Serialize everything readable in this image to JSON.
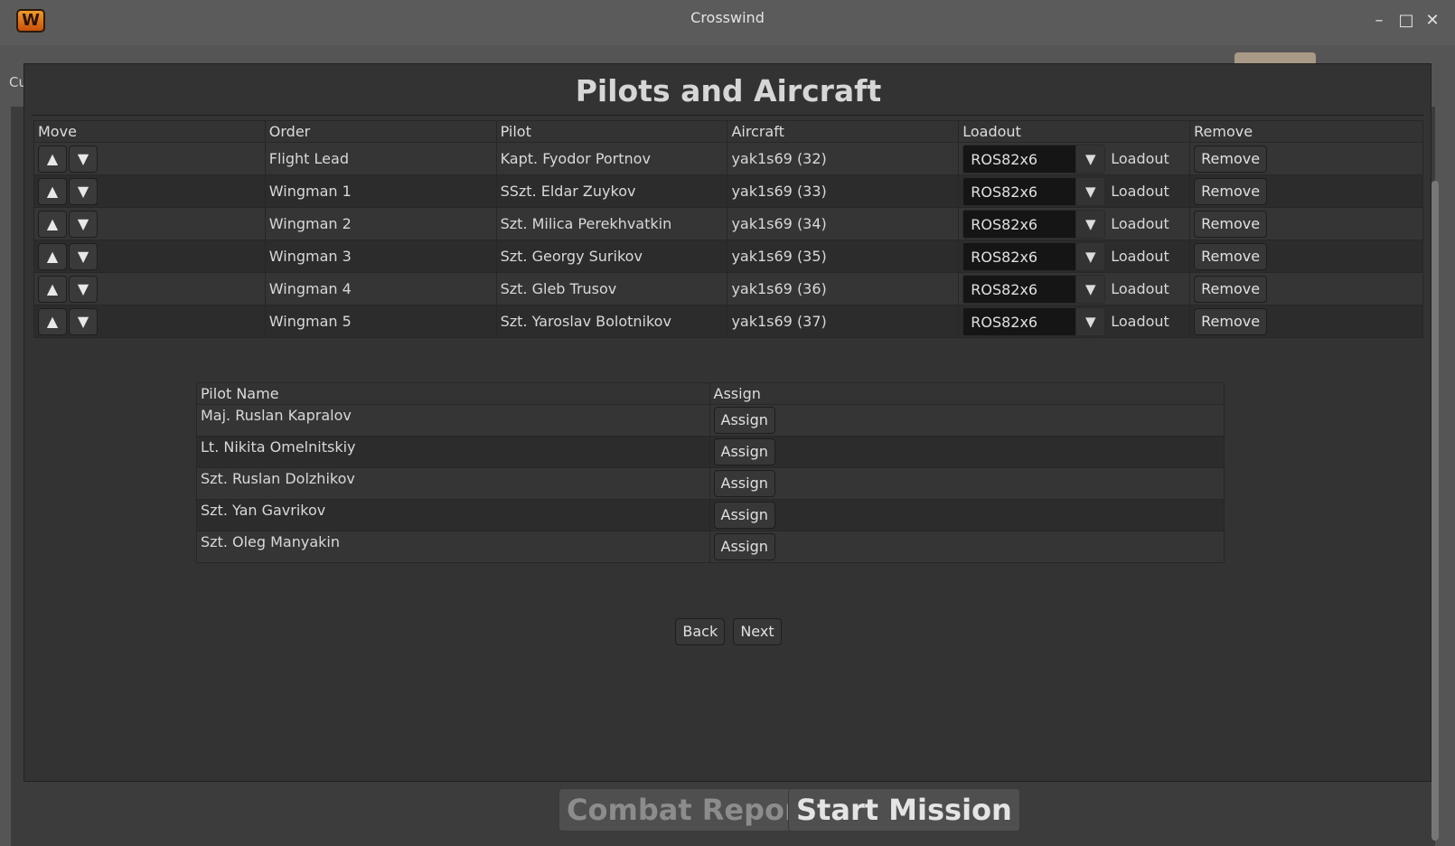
{
  "window": {
    "title": "Crosswind",
    "logo": "W",
    "minimize_icon": "–",
    "maximize_icon": "□",
    "close_icon": "✕"
  },
  "background": {
    "cut_label": "Cu"
  },
  "dialog": {
    "title": "Pilots and Aircraft"
  },
  "flight_table": {
    "headers": [
      "Move",
      "Order",
      "Pilot",
      "Aircraft",
      "Loadout",
      "Remove"
    ],
    "up_icon": "▲",
    "down_icon": "▼",
    "combo_arrow": "▼",
    "loadout_label": "Loadout",
    "remove_label": "Remove",
    "rows": [
      {
        "order": "Flight Lead",
        "pilot": "Kapt. Fyodor Portnov",
        "aircraft": "yak1s69 (32)",
        "loadout": "ROS82x6"
      },
      {
        "order": "Wingman 1",
        "pilot": "SSzt. Eldar Zuykov",
        "aircraft": "yak1s69 (33)",
        "loadout": "ROS82x6"
      },
      {
        "order": "Wingman 2",
        "pilot": "Szt. Milica Perekhvatkin",
        "aircraft": "yak1s69 (34)",
        "loadout": "ROS82x6"
      },
      {
        "order": "Wingman 3",
        "pilot": "Szt. Georgy Surikov",
        "aircraft": "yak1s69 (35)",
        "loadout": "ROS82x6"
      },
      {
        "order": "Wingman 4",
        "pilot": "Szt. Gleb Trusov",
        "aircraft": "yak1s69 (36)",
        "loadout": "ROS82x6",
        "highlight_color": "#e9c62a"
      },
      {
        "order": "Wingman 5",
        "pilot": "Szt. Yaroslav Bolotnikov",
        "aircraft": "yak1s69 (37)",
        "loadout": "ROS82x6"
      }
    ]
  },
  "pilot_table": {
    "headers": [
      "Pilot Name",
      "Assign"
    ],
    "assign_label": "Assign",
    "rows": [
      {
        "name": "Maj. Ruslan Kapralov"
      },
      {
        "name": "Lt. Nikita Omelnitskiy"
      },
      {
        "name": "Szt. Ruslan Dolzhikov"
      },
      {
        "name": "Szt. Yan Gavrikov"
      },
      {
        "name": "Szt. Oleg Manyakin"
      }
    ]
  },
  "nav": {
    "back_label": "Back",
    "next_label": "Next"
  },
  "bottom": {
    "combat_report_label": "Combat Report",
    "start_mission_label": "Start Mission"
  }
}
